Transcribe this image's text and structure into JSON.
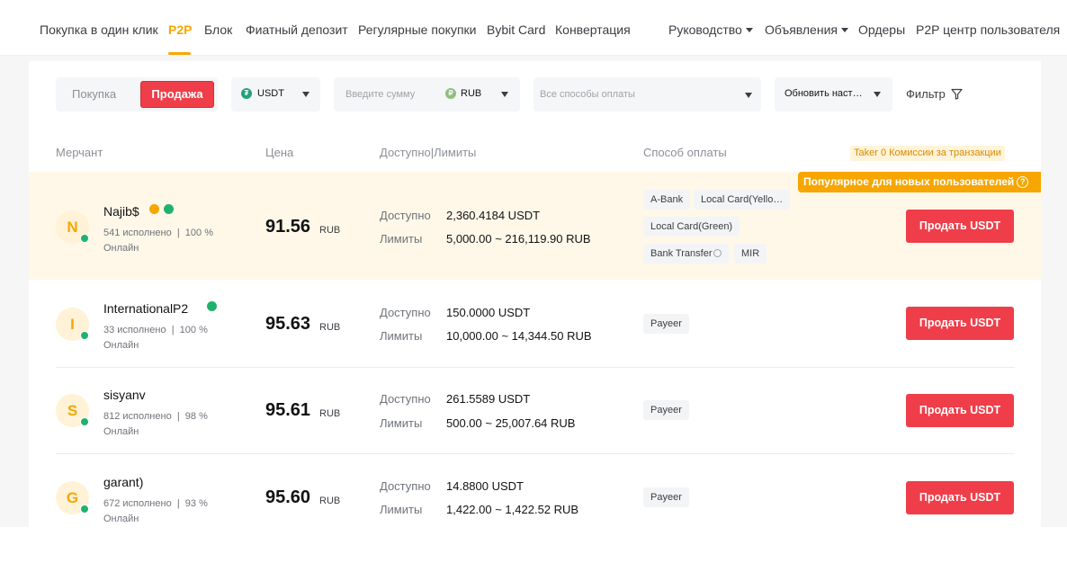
{
  "nav": {
    "left": [
      "Покупка в один клик",
      "P2P",
      "Блок",
      "Фиатный депозит",
      "Регулярные покупки",
      "Bybit Card",
      "Конвертация"
    ],
    "right": [
      "Руководство",
      "Объявления",
      "Ордеры",
      "P2P центр пользователя"
    ]
  },
  "filters": {
    "buy_label": "Покупка",
    "sell_label": "Продажа",
    "coin": "USDT",
    "amount_placeholder": "Введите сумму",
    "currency": "RUB",
    "payment_placeholder": "Все способы оплаты",
    "refresh_label": "Обновить наст…",
    "filter_label": "Фильтр"
  },
  "table": {
    "headers": {
      "merchant": "Мерчант",
      "price": "Цена",
      "available": "Доступно|Лимиты",
      "payment": "Способ оплаты"
    },
    "taker_note": "Taker 0 Комиссии за транзакции",
    "popular_label": "Популярное для новых пользователей",
    "available_label": "Доступно",
    "limits_label": "Лимиты",
    "price_currency": "RUB",
    "rows": [
      {
        "initial": "N",
        "name": "Najib$",
        "orders": "541 исполнено",
        "completion": "100 %",
        "status": "Онлайн",
        "price": "91.56",
        "available": "2,360.4184 USDT",
        "limits": "5,000.00 ~ 216,119.90 RUB",
        "payments": [
          "A-Bank",
          "Local Card(Yello…",
          "Local Card(Green)",
          "Bank Transfer",
          "MIR"
        ],
        "button": "Продать USDT"
      },
      {
        "initial": "I",
        "name": "InternationalP2",
        "orders": "33 исполнено",
        "completion": "100 %",
        "status": "Онлайн",
        "price": "95.63",
        "available": "150.0000 USDT",
        "limits": "10,000.00 ~ 14,344.50 RUB",
        "payments": [
          "Payeer"
        ],
        "button": "Продать USDT"
      },
      {
        "initial": "S",
        "name": "sisyanv",
        "orders": "812 исполнено",
        "completion": "98 %",
        "status": "Онлайн",
        "price": "95.61",
        "available": "261.5589 USDT",
        "limits": "500.00 ~ 25,007.64 RUB",
        "payments": [
          "Payeer"
        ],
        "button": "Продать USDT"
      },
      {
        "initial": "G",
        "name": "garant)",
        "orders": "672 исполнено",
        "completion": "93 %",
        "status": "Онлайн",
        "price": "95.60",
        "available": "14.8800 USDT",
        "limits": "1,422.00 ~ 1,422.52 RUB",
        "payments": [
          "Payeer"
        ],
        "button": "Продать USDT"
      }
    ]
  },
  "colors": {
    "accent": "#f7a600",
    "sell": "#ef3e49",
    "online": "#20b26c"
  }
}
